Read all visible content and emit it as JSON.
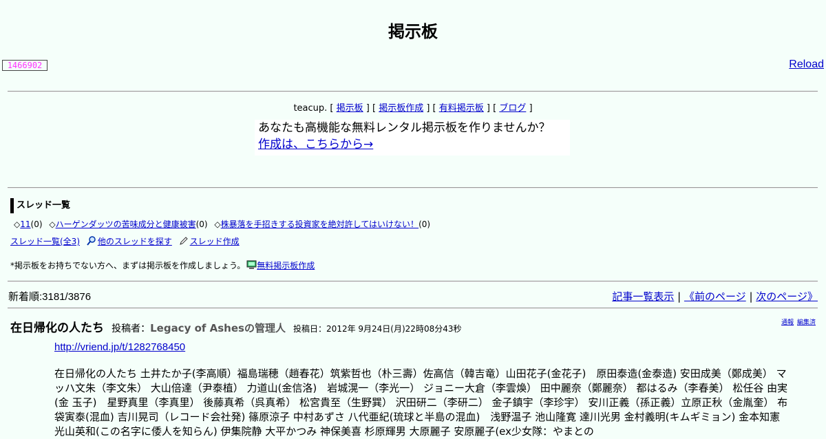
{
  "page": {
    "title": "掲示板",
    "counter": "1466902",
    "reload_label": "Reload"
  },
  "teacup": {
    "prefix": "teacup.",
    "links": [
      "掲示板",
      "掲示板作成",
      "有料掲示板",
      "ブログ"
    ]
  },
  "promo": {
    "text": "あなたも高機能な無料レンタル掲示板を作りませんか？",
    "link": "作成は、こちらから→"
  },
  "threads": {
    "heading": "スレッド一覧",
    "items": [
      {
        "label": "11",
        "count": "(0)"
      },
      {
        "label": "ハーゲンダッツの苦味成分と健康被害",
        "count": "(0)"
      },
      {
        "label": "株暴落を手招きする投資家を絶対許してはいけない！",
        "count": "(0)"
      }
    ],
    "all_link": "スレッド一覧(全3)",
    "search_link": "他のスレッドを探す",
    "create_link": "スレッド作成",
    "note": "*掲示板をお持ちでない方へ、まずは掲示板を作成しましょう。",
    "note_link": "無料掲示板作成"
  },
  "nav": {
    "new_count": "新着順:3181/3876",
    "list_link": "記事一覧表示",
    "sep": "|",
    "prev_link": "《前のページ",
    "next_link": "次のページ》"
  },
  "post": {
    "title": "在日帰化の人たち",
    "by_label": "投稿者：",
    "author": "Legacy of Ashesの管理人",
    "date": "投稿日：2012年 9月24日(月)22時08分43秒",
    "report": "通報",
    "edit": "編集済",
    "url": "http://vriend.jp/t/1282768450",
    "body": "在日帰化の人たち 土井たか子(李高順）福島瑞穂（趙春花）筑紫哲也（朴三壽）佐高信（韓吉竜）山田花子(金花子)　原田泰造(金泰造) 安田成美（鄭成美） マッハ文朱（李文朱） 大山倍達（尹泰植） 力道山(金信洛)　岩城滉一（李光一） ジョニー大倉（李雲煥） 田中麗奈（鄭麗奈） 都はるみ（李春美） 松任谷 由実(金 玉子)　星野真里（李真里） 後藤真希（呉真希） 松宮貴至（生野巽） 沢田研二（李研二） 金子鎮宇（李珍宇） 安川正義（孫正義）立原正秋（金胤奎） 布袋寅泰(混血) 吉川晃司（レコード会社発) 篠原涼子 中村あずさ 八代亜紀(琉球と半島の混血)　浅野温子 池山隆寛 達川光男 金村義明(キムギミョン) 金本知憲 光山英和(この名字に倭人を知らん) 伊集院静 大平かつみ 神保美喜 杉原輝男 大原麗子 安原麗子(ex少女隊：やまとの"
  }
}
